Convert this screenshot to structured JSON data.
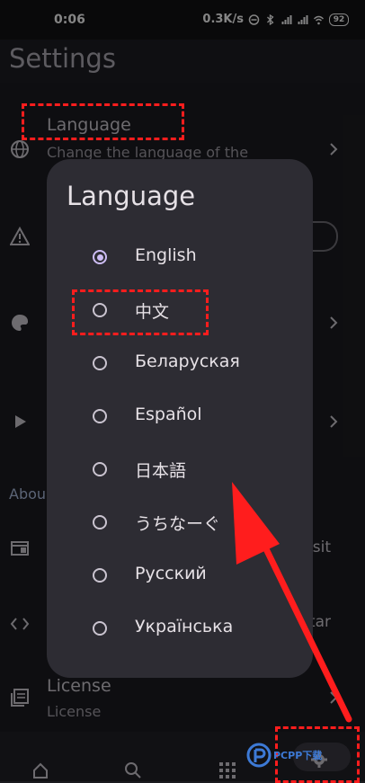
{
  "status_bar": {
    "time": "0:06",
    "speed": "0.3K/s",
    "battery": "92"
  },
  "header": {
    "title": "Settings"
  },
  "settings": {
    "language_title": "Language",
    "language_subtitle": "Change the language of the",
    "about_label": "Abou",
    "row_website_text": "sit",
    "row_source_text": "tar",
    "license_title": "License",
    "license_subtitle": "License"
  },
  "dialog": {
    "title": "Language",
    "selected": "English",
    "options": [
      "English",
      "中文",
      "Беларуская",
      "Español",
      "日本語",
      "うちなーぐ",
      "Русский",
      "Українська"
    ]
  },
  "watermark": {
    "text": "PCPP下载"
  },
  "colors": {
    "annotation": "#ff1d1d",
    "dialog_bg": "#2d2c33",
    "radio_selected": "#cdbdf5",
    "app_bg": "#1b1b1f"
  },
  "icons": [
    "globe-icon",
    "warning-icon",
    "palette-icon",
    "play-icon",
    "web-icon",
    "code-icon",
    "license-icon",
    "home-icon",
    "search-icon",
    "apps-icon",
    "settings-icon",
    "chevron-right-icon"
  ]
}
